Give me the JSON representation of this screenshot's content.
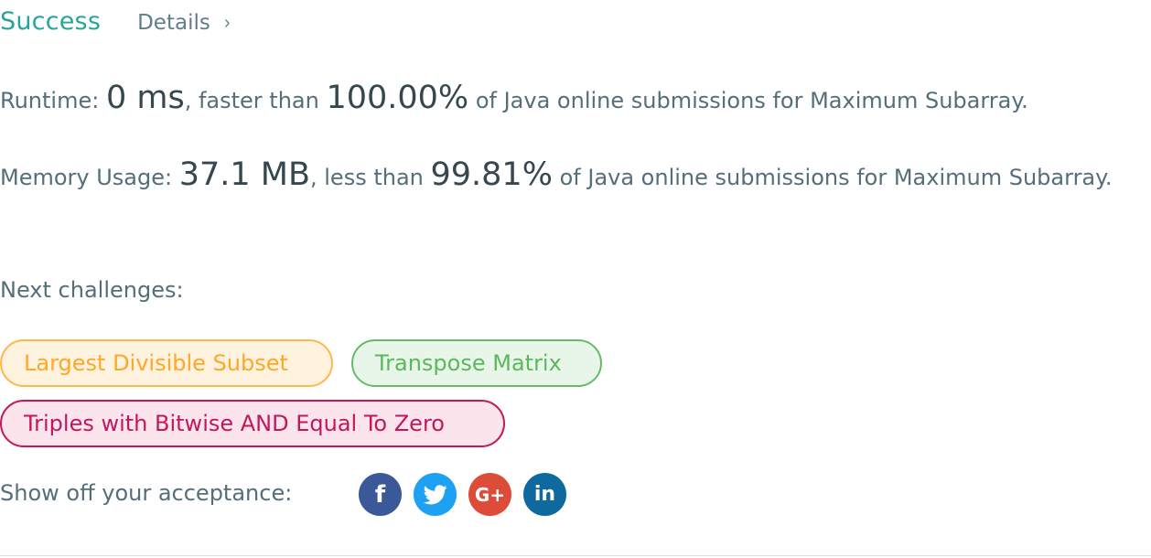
{
  "header": {
    "status": "Success",
    "details_label": "Details",
    "details_chevron": "›"
  },
  "runtime": {
    "label": "Runtime: ",
    "value": "0 ms",
    "comparison_text": ", faster than ",
    "percent": "100.00%",
    "suffix": " of Java online submissions for Maximum Subarray."
  },
  "memory": {
    "label": "Memory Usage: ",
    "value": "37.1 MB",
    "comparison_text": ", less than ",
    "percent": "99.81%",
    "suffix": " of Java online submissions for Maximum Subarray."
  },
  "next_challenges": {
    "label": "Next challenges:",
    "items": [
      {
        "title": "Largest Divisible Subset",
        "difficulty_color": "#ffa726"
      },
      {
        "title": "Transpose Matrix",
        "difficulty_color": "#5cb85c"
      },
      {
        "title": "Triples with Bitwise AND Equal To Zero",
        "difficulty_color": "#c2185b"
      }
    ]
  },
  "share": {
    "label": "Show off your acceptance:",
    "buttons": [
      {
        "icon": "facebook-icon",
        "glyph": "f",
        "color": "#3b5998"
      },
      {
        "icon": "twitter-icon",
        "glyph": "",
        "color": "#1da1f2"
      },
      {
        "icon": "google-plus-icon",
        "glyph": "G+",
        "color": "#dd4b39"
      },
      {
        "icon": "linkedin-icon",
        "glyph": "in",
        "color": "#0e6a9e"
      }
    ]
  }
}
